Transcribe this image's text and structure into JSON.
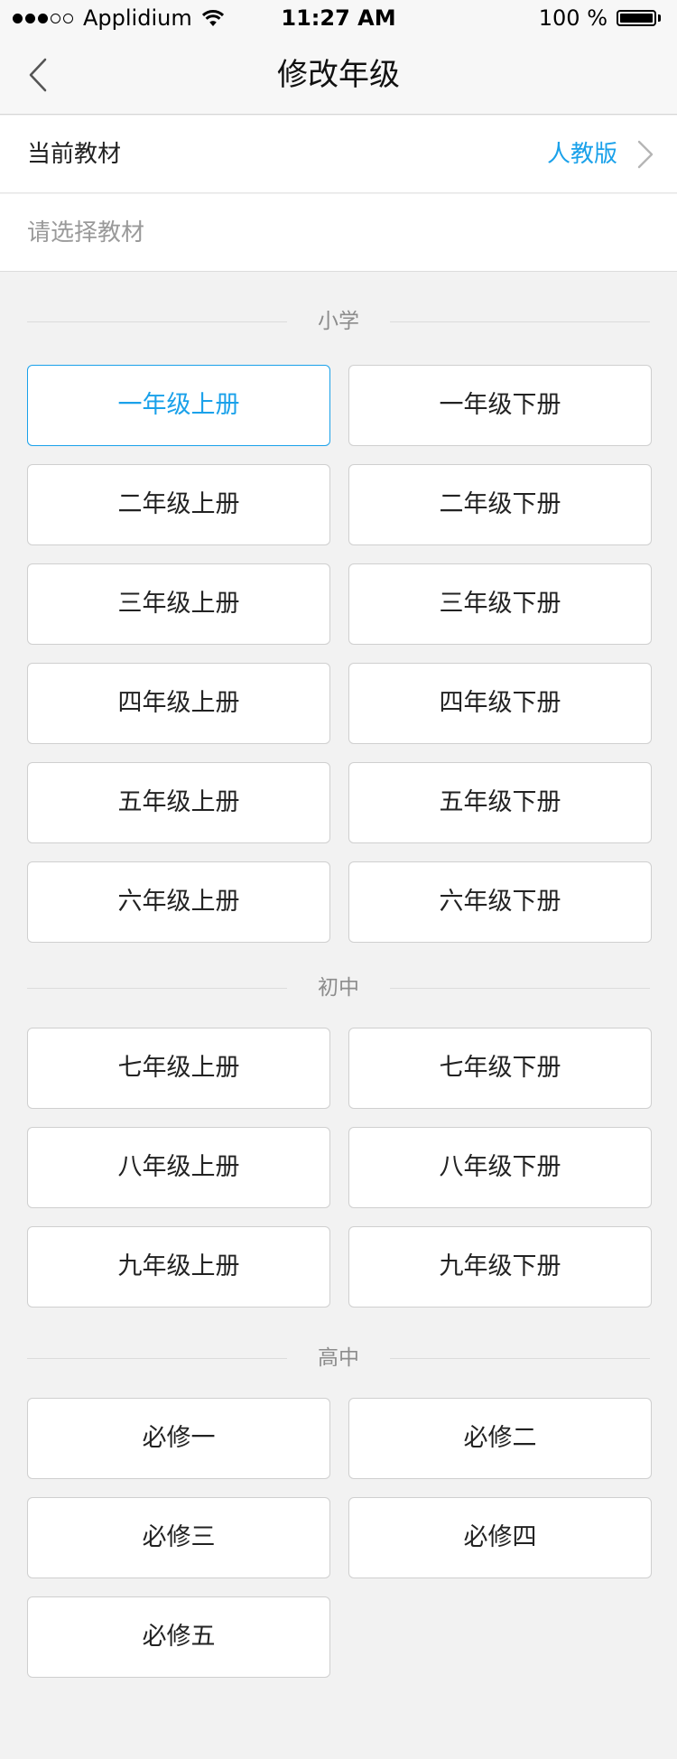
{
  "status_bar": {
    "carrier": "Applidium",
    "time": "11:27 AM",
    "battery": "100 %"
  },
  "nav": {
    "title": "修改年级"
  },
  "current_textbook": {
    "label": "当前教材",
    "value": "人教版"
  },
  "select_textbook": {
    "placeholder": "请选择教材"
  },
  "sections": [
    {
      "title": "小学",
      "grades": [
        "一年级上册",
        "一年级下册",
        "二年级上册",
        "二年级下册",
        "三年级上册",
        "三年级下册",
        "四年级上册",
        "四年级下册",
        "五年级上册",
        "五年级下册",
        "六年级上册",
        "六年级下册"
      ]
    },
    {
      "title": "初中",
      "grades": [
        "七年级上册",
        "七年级下册",
        "八年级上册",
        "八年级下册",
        "九年级上册",
        "九年级下册"
      ]
    },
    {
      "title": "高中",
      "grades": [
        "必修一",
        "必修二",
        "必修三",
        "必修四",
        "必修五"
      ]
    }
  ],
  "selected_grade": "一年级上册",
  "colors": {
    "accent": "#1aa1ea",
    "background": "#f2f2f2"
  }
}
